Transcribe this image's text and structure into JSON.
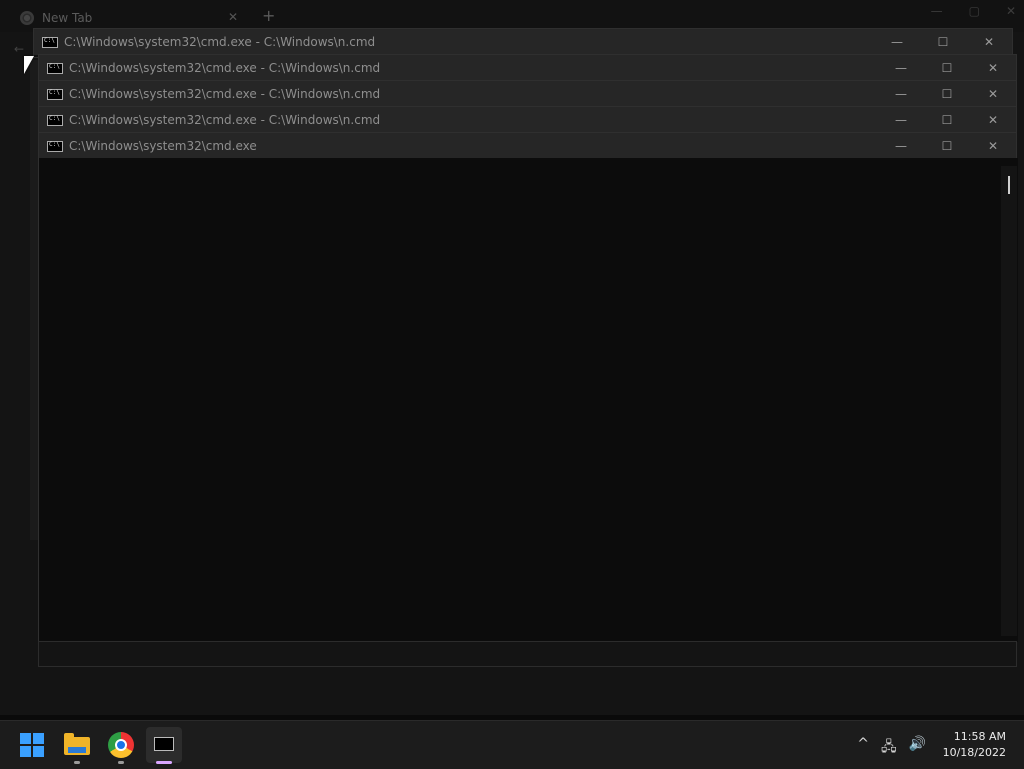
{
  "chrome": {
    "tab_title": "New Tab",
    "tab_close": "✕",
    "new_tab": "+",
    "back": "←",
    "win_min": "—",
    "win_max": "▢",
    "win_close": "✕"
  },
  "cmd_windows": [
    {
      "title": "C:\\Windows\\system32\\cmd.exe - C:\\Windows\\n.cmd"
    },
    {
      "title": "C:\\Windows\\system32\\cmd.exe - C:\\Windows\\n.cmd"
    },
    {
      "title": "C:\\Windows\\system32\\cmd.exe - C:\\Windows\\n.cmd"
    },
    {
      "title": "C:\\Windows\\system32\\cmd.exe - C:\\Windows\\n.cmd"
    },
    {
      "title": "C:\\Windows\\system32\\cmd.exe"
    }
  ],
  "window_buttons": {
    "minimize": "—",
    "maximize": "☐",
    "close": "✕"
  },
  "taskbar": {
    "items": [
      "start-icon",
      "file-explorer-icon",
      "chrome-icon",
      "cmd-icon"
    ],
    "tray": {
      "chevron": "^",
      "network": "🖧",
      "volume": "🔊"
    },
    "time": "11:58 AM",
    "date": "10/18/2022"
  }
}
